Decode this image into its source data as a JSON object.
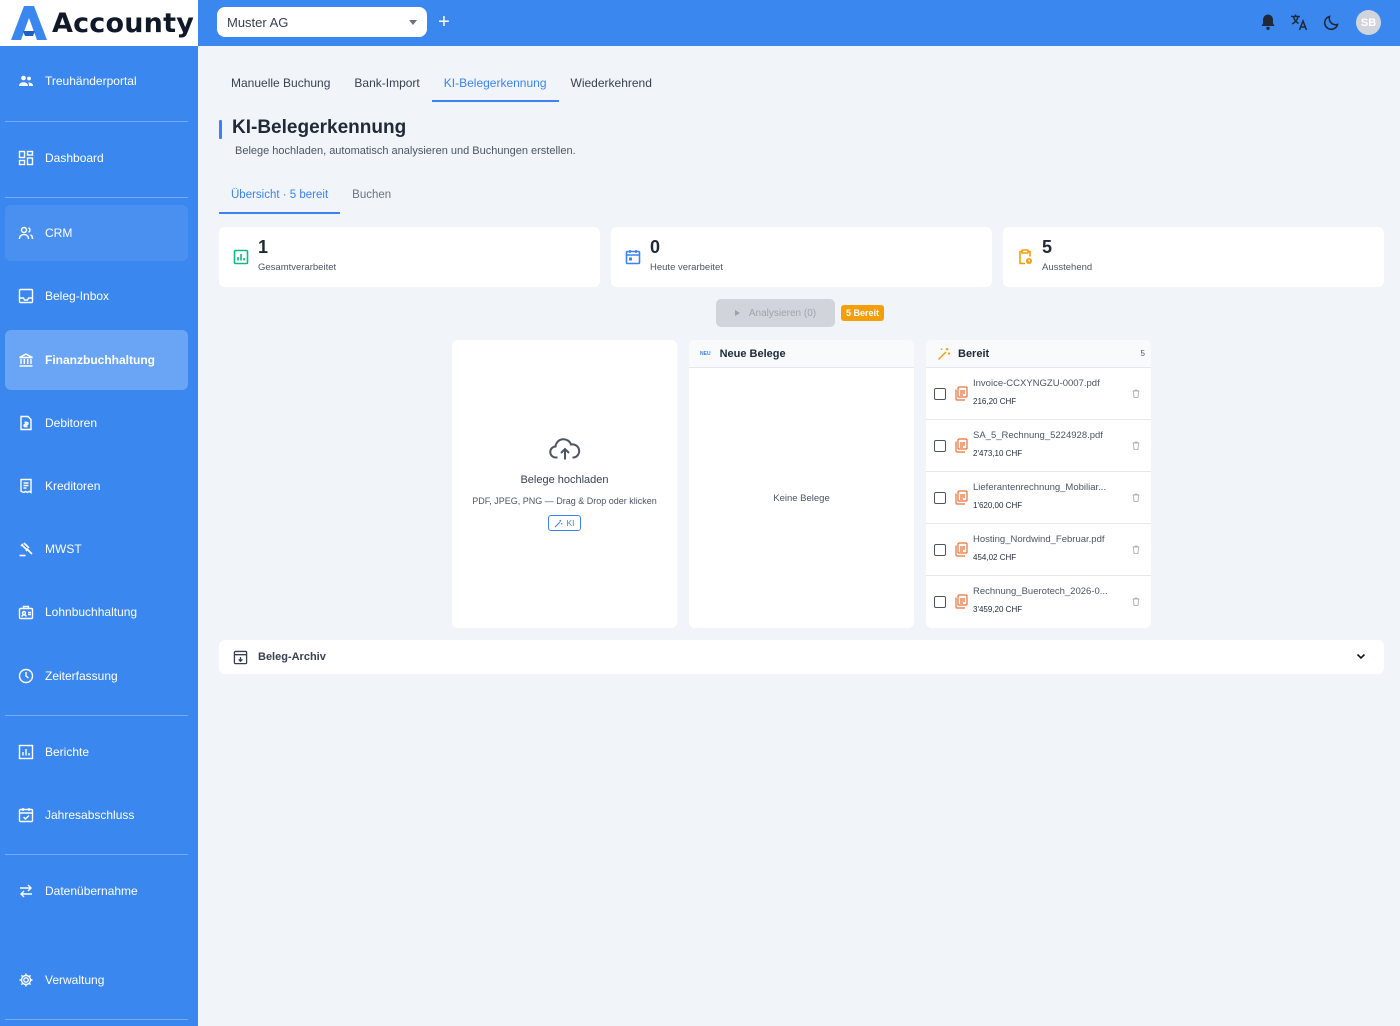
{
  "app": {
    "name": "Accounty",
    "brand_color": "#3b87f0"
  },
  "topbar": {
    "company": "Muster AG",
    "add_label": "+",
    "avatar_initials": "SB"
  },
  "sidebar": {
    "items": [
      {
        "label": "Treuhänderportal",
        "icon": "users-icon"
      },
      {
        "label": "Dashboard",
        "icon": "dashboard-icon"
      },
      {
        "label": "CRM",
        "icon": "contacts-icon"
      },
      {
        "label": "Beleg-Inbox",
        "icon": "inbox-icon"
      },
      {
        "label": "Finanzbuchhaltung",
        "icon": "bank-icon",
        "active": true
      },
      {
        "label": "Debitoren",
        "icon": "invoice-icon"
      },
      {
        "label": "Kreditoren",
        "icon": "receipt-icon"
      },
      {
        "label": "MWST",
        "icon": "gavel-icon"
      },
      {
        "label": "Lohnbuchhaltung",
        "icon": "payroll-icon"
      },
      {
        "label": "Zeiterfassung",
        "icon": "clock-icon"
      },
      {
        "label": "Berichte",
        "icon": "chart-icon"
      },
      {
        "label": "Jahresabschluss",
        "icon": "calendar-check-icon"
      },
      {
        "label": "Datenübernahme",
        "icon": "transfer-icon"
      },
      {
        "label": "Verwaltung",
        "icon": "gear-icon"
      }
    ]
  },
  "tabs": [
    "Manuelle Buchung",
    "Bank-Import",
    "KI-Belegerkennung",
    "Wiederkehrend"
  ],
  "page": {
    "title": "KI-Belegerkennung",
    "subtitle": "Belege hochladen, automatisch analysieren und Buchungen erstellen."
  },
  "subtabs": [
    "Übersicht · 5 bereit",
    "Buchen"
  ],
  "stats": [
    {
      "value": "1",
      "label": "Gesamtverarbeitet",
      "color": "#10b981"
    },
    {
      "value": "0",
      "label": "Heute verarbeitet",
      "color": "#3b82f6"
    },
    {
      "value": "5",
      "label": "Ausstehend",
      "color": "#f59e0b"
    }
  ],
  "actions": {
    "analyze_label": "Analysieren (0)",
    "ready_badge": "5 Bereit"
  },
  "upload": {
    "title": "Belege hochladen",
    "hint": "PDF, JPEG, PNG — Drag & Drop oder klicken",
    "ki_label": "KI"
  },
  "new_docs": {
    "title": "Neue Belege",
    "tag": "NEU",
    "empty_text": "Keine Belege"
  },
  "ready": {
    "title": "Bereit",
    "count": "5",
    "items": [
      {
        "name": "Invoice-CCXYNGZU-0007.pdf",
        "amount": "216,20 CHF"
      },
      {
        "name": "SA_5_Rechnung_5224928.pdf",
        "amount": "2'473,10 CHF"
      },
      {
        "name": "Lieferantenrechnung_Mobiliar...",
        "amount": "1'620,00 CHF"
      },
      {
        "name": "Hosting_Nordwind_Februar.pdf",
        "amount": "454,02 CHF"
      },
      {
        "name": "Rechnung_Buerotech_2026-0...",
        "amount": "3'459,20 CHF"
      }
    ]
  },
  "archive": {
    "title": "Beleg-Archiv"
  }
}
